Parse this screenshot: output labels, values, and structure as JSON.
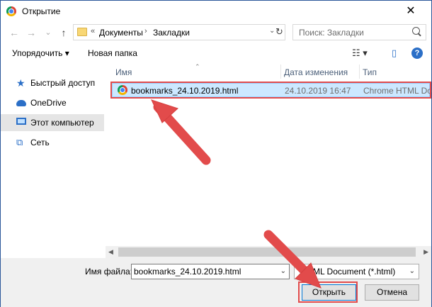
{
  "window": {
    "title": "Открытие",
    "close_glyph": "✕"
  },
  "nav": {
    "back_glyph": "←",
    "forward_glyph": "→",
    "recent_glyph": "⌄",
    "up_glyph": "↑",
    "breadcrumb": [
      "Документы",
      "Закладки"
    ],
    "breadcrumb_prefix": "«",
    "breadcrumb_sep": "›",
    "refresh_glyph": "↻",
    "dropdown_glyph": "⌄"
  },
  "search": {
    "placeholder": "Поиск: Закладки"
  },
  "toolbar": {
    "organize_label": "Упорядочить ▾",
    "new_folder_label": "Новая папка",
    "view_glyph": "☷ ▾",
    "pane_glyph": "▯",
    "help_glyph": "?"
  },
  "sidebar": {
    "items": [
      {
        "label": "Быстрый доступ",
        "icon": "star-icon"
      },
      {
        "label": "OneDrive",
        "icon": "cloud-icon"
      },
      {
        "label": "Этот компьютер",
        "icon": "computer-icon"
      },
      {
        "label": "Сеть",
        "icon": "network-icon"
      }
    ]
  },
  "list": {
    "columns": [
      "Имя",
      "Дата изменения",
      "Тип"
    ],
    "sort_glyph": "⌃",
    "files": [
      {
        "name": "bookmarks_24.10.2019.html",
        "date": "24.10.2019 16:47",
        "type": "Chrome HTML Do..."
      }
    ]
  },
  "hscroll": {
    "left_glyph": "◀",
    "right_glyph": "▶"
  },
  "footer": {
    "filename_label": "Имя файла:",
    "filename_value": "bookmarks_24.10.2019.html",
    "filetype_value": "ML Document (*.html)",
    "dropdown_glyph": "⌄",
    "open_label": "Открыть",
    "cancel_label": "Отмена"
  },
  "colors": {
    "accent": "#0078d7",
    "highlight_red": "#e24b4b",
    "selection": "#cce8ff"
  }
}
